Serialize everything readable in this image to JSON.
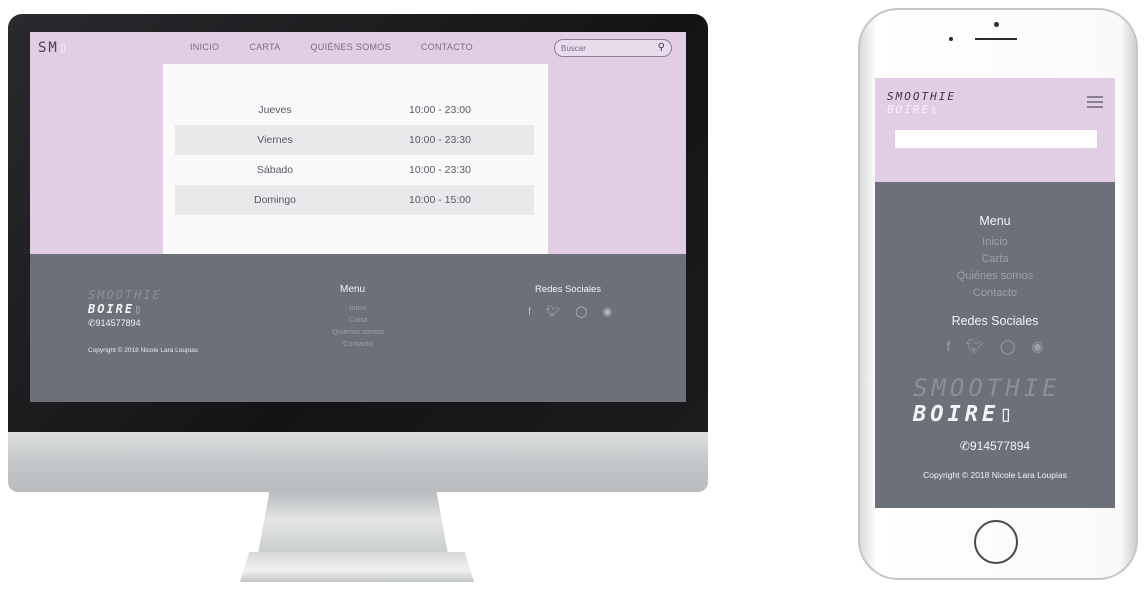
{
  "desktop": {
    "logo": "SM",
    "nav": [
      "INICIO",
      "CARTA",
      "QUIÉNES SOMOS",
      "CONTACTO"
    ],
    "search_placeholder": "Buscar",
    "search_icon": "search-icon",
    "hours": [
      {
        "day": "Jueves",
        "time": "10:00 - 23:00"
      },
      {
        "day": "Viernes",
        "time": "10:00 - 23:30"
      },
      {
        "day": "Sábado",
        "time": "10:00 - 23:30"
      },
      {
        "day": "Domingo",
        "time": "10:00 - 15:00"
      }
    ],
    "footer": {
      "logo_line1": "SMOOTHIE",
      "logo_line2": "BOIRE",
      "phone": "914577894",
      "copyright": "Copyright © 2018 Nicole Lara Loupias",
      "menu_title": "Menu",
      "menu_items": [
        "Inicio",
        "Carta",
        "Quiénes somos",
        "Contacto"
      ],
      "social_title": "Redes Sociales",
      "social_icons": [
        "facebook-icon",
        "twitter-icon",
        "instagram-icon",
        "pinterest-icon"
      ]
    }
  },
  "mobile": {
    "logo_line1": "SMOOTHIE",
    "logo_line2": "BOIRE",
    "menu_title": "Menu",
    "menu_items": [
      "Inicio",
      "Carta",
      "Quiénes somos",
      "Contacto"
    ],
    "social_title": "Redes Sociales",
    "logo_big_line1": "SMOOTHIE",
    "logo_big_line2": "BOIRE",
    "phone": "914577894",
    "copyright": "Copyright © 2018 Nicole Lara Loupias"
  },
  "colors": {
    "header_bg": "#e1cde4",
    "footer_bg": "#6b7079",
    "card_bg": "#fafafa",
    "row_shade": "#e9e9ec"
  }
}
